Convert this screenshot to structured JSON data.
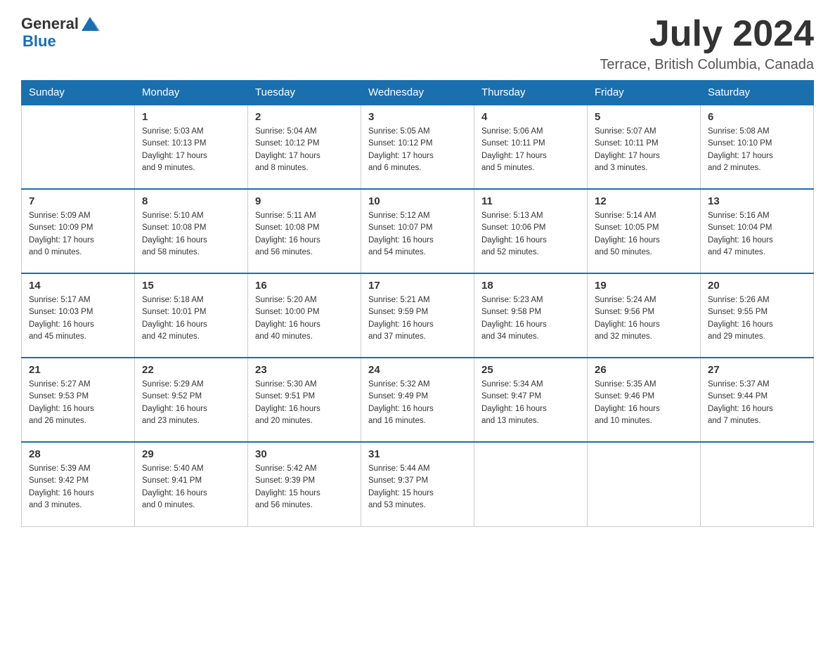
{
  "header": {
    "logo_general": "General",
    "logo_blue": "Blue",
    "month": "July 2024",
    "location": "Terrace, British Columbia, Canada"
  },
  "weekdays": [
    "Sunday",
    "Monday",
    "Tuesday",
    "Wednesday",
    "Thursday",
    "Friday",
    "Saturday"
  ],
  "weeks": [
    [
      {
        "day": "",
        "info": ""
      },
      {
        "day": "1",
        "info": "Sunrise: 5:03 AM\nSunset: 10:13 PM\nDaylight: 17 hours\nand 9 minutes."
      },
      {
        "day": "2",
        "info": "Sunrise: 5:04 AM\nSunset: 10:12 PM\nDaylight: 17 hours\nand 8 minutes."
      },
      {
        "day": "3",
        "info": "Sunrise: 5:05 AM\nSunset: 10:12 PM\nDaylight: 17 hours\nand 6 minutes."
      },
      {
        "day": "4",
        "info": "Sunrise: 5:06 AM\nSunset: 10:11 PM\nDaylight: 17 hours\nand 5 minutes."
      },
      {
        "day": "5",
        "info": "Sunrise: 5:07 AM\nSunset: 10:11 PM\nDaylight: 17 hours\nand 3 minutes."
      },
      {
        "day": "6",
        "info": "Sunrise: 5:08 AM\nSunset: 10:10 PM\nDaylight: 17 hours\nand 2 minutes."
      }
    ],
    [
      {
        "day": "7",
        "info": "Sunrise: 5:09 AM\nSunset: 10:09 PM\nDaylight: 17 hours\nand 0 minutes."
      },
      {
        "day": "8",
        "info": "Sunrise: 5:10 AM\nSunset: 10:08 PM\nDaylight: 16 hours\nand 58 minutes."
      },
      {
        "day": "9",
        "info": "Sunrise: 5:11 AM\nSunset: 10:08 PM\nDaylight: 16 hours\nand 56 minutes."
      },
      {
        "day": "10",
        "info": "Sunrise: 5:12 AM\nSunset: 10:07 PM\nDaylight: 16 hours\nand 54 minutes."
      },
      {
        "day": "11",
        "info": "Sunrise: 5:13 AM\nSunset: 10:06 PM\nDaylight: 16 hours\nand 52 minutes."
      },
      {
        "day": "12",
        "info": "Sunrise: 5:14 AM\nSunset: 10:05 PM\nDaylight: 16 hours\nand 50 minutes."
      },
      {
        "day": "13",
        "info": "Sunrise: 5:16 AM\nSunset: 10:04 PM\nDaylight: 16 hours\nand 47 minutes."
      }
    ],
    [
      {
        "day": "14",
        "info": "Sunrise: 5:17 AM\nSunset: 10:03 PM\nDaylight: 16 hours\nand 45 minutes."
      },
      {
        "day": "15",
        "info": "Sunrise: 5:18 AM\nSunset: 10:01 PM\nDaylight: 16 hours\nand 42 minutes."
      },
      {
        "day": "16",
        "info": "Sunrise: 5:20 AM\nSunset: 10:00 PM\nDaylight: 16 hours\nand 40 minutes."
      },
      {
        "day": "17",
        "info": "Sunrise: 5:21 AM\nSunset: 9:59 PM\nDaylight: 16 hours\nand 37 minutes."
      },
      {
        "day": "18",
        "info": "Sunrise: 5:23 AM\nSunset: 9:58 PM\nDaylight: 16 hours\nand 34 minutes."
      },
      {
        "day": "19",
        "info": "Sunrise: 5:24 AM\nSunset: 9:56 PM\nDaylight: 16 hours\nand 32 minutes."
      },
      {
        "day": "20",
        "info": "Sunrise: 5:26 AM\nSunset: 9:55 PM\nDaylight: 16 hours\nand 29 minutes."
      }
    ],
    [
      {
        "day": "21",
        "info": "Sunrise: 5:27 AM\nSunset: 9:53 PM\nDaylight: 16 hours\nand 26 minutes."
      },
      {
        "day": "22",
        "info": "Sunrise: 5:29 AM\nSunset: 9:52 PM\nDaylight: 16 hours\nand 23 minutes."
      },
      {
        "day": "23",
        "info": "Sunrise: 5:30 AM\nSunset: 9:51 PM\nDaylight: 16 hours\nand 20 minutes."
      },
      {
        "day": "24",
        "info": "Sunrise: 5:32 AM\nSunset: 9:49 PM\nDaylight: 16 hours\nand 16 minutes."
      },
      {
        "day": "25",
        "info": "Sunrise: 5:34 AM\nSunset: 9:47 PM\nDaylight: 16 hours\nand 13 minutes."
      },
      {
        "day": "26",
        "info": "Sunrise: 5:35 AM\nSunset: 9:46 PM\nDaylight: 16 hours\nand 10 minutes."
      },
      {
        "day": "27",
        "info": "Sunrise: 5:37 AM\nSunset: 9:44 PM\nDaylight: 16 hours\nand 7 minutes."
      }
    ],
    [
      {
        "day": "28",
        "info": "Sunrise: 5:39 AM\nSunset: 9:42 PM\nDaylight: 16 hours\nand 3 minutes."
      },
      {
        "day": "29",
        "info": "Sunrise: 5:40 AM\nSunset: 9:41 PM\nDaylight: 16 hours\nand 0 minutes."
      },
      {
        "day": "30",
        "info": "Sunrise: 5:42 AM\nSunset: 9:39 PM\nDaylight: 15 hours\nand 56 minutes."
      },
      {
        "day": "31",
        "info": "Sunrise: 5:44 AM\nSunset: 9:37 PM\nDaylight: 15 hours\nand 53 minutes."
      },
      {
        "day": "",
        "info": ""
      },
      {
        "day": "",
        "info": ""
      },
      {
        "day": "",
        "info": ""
      }
    ]
  ]
}
